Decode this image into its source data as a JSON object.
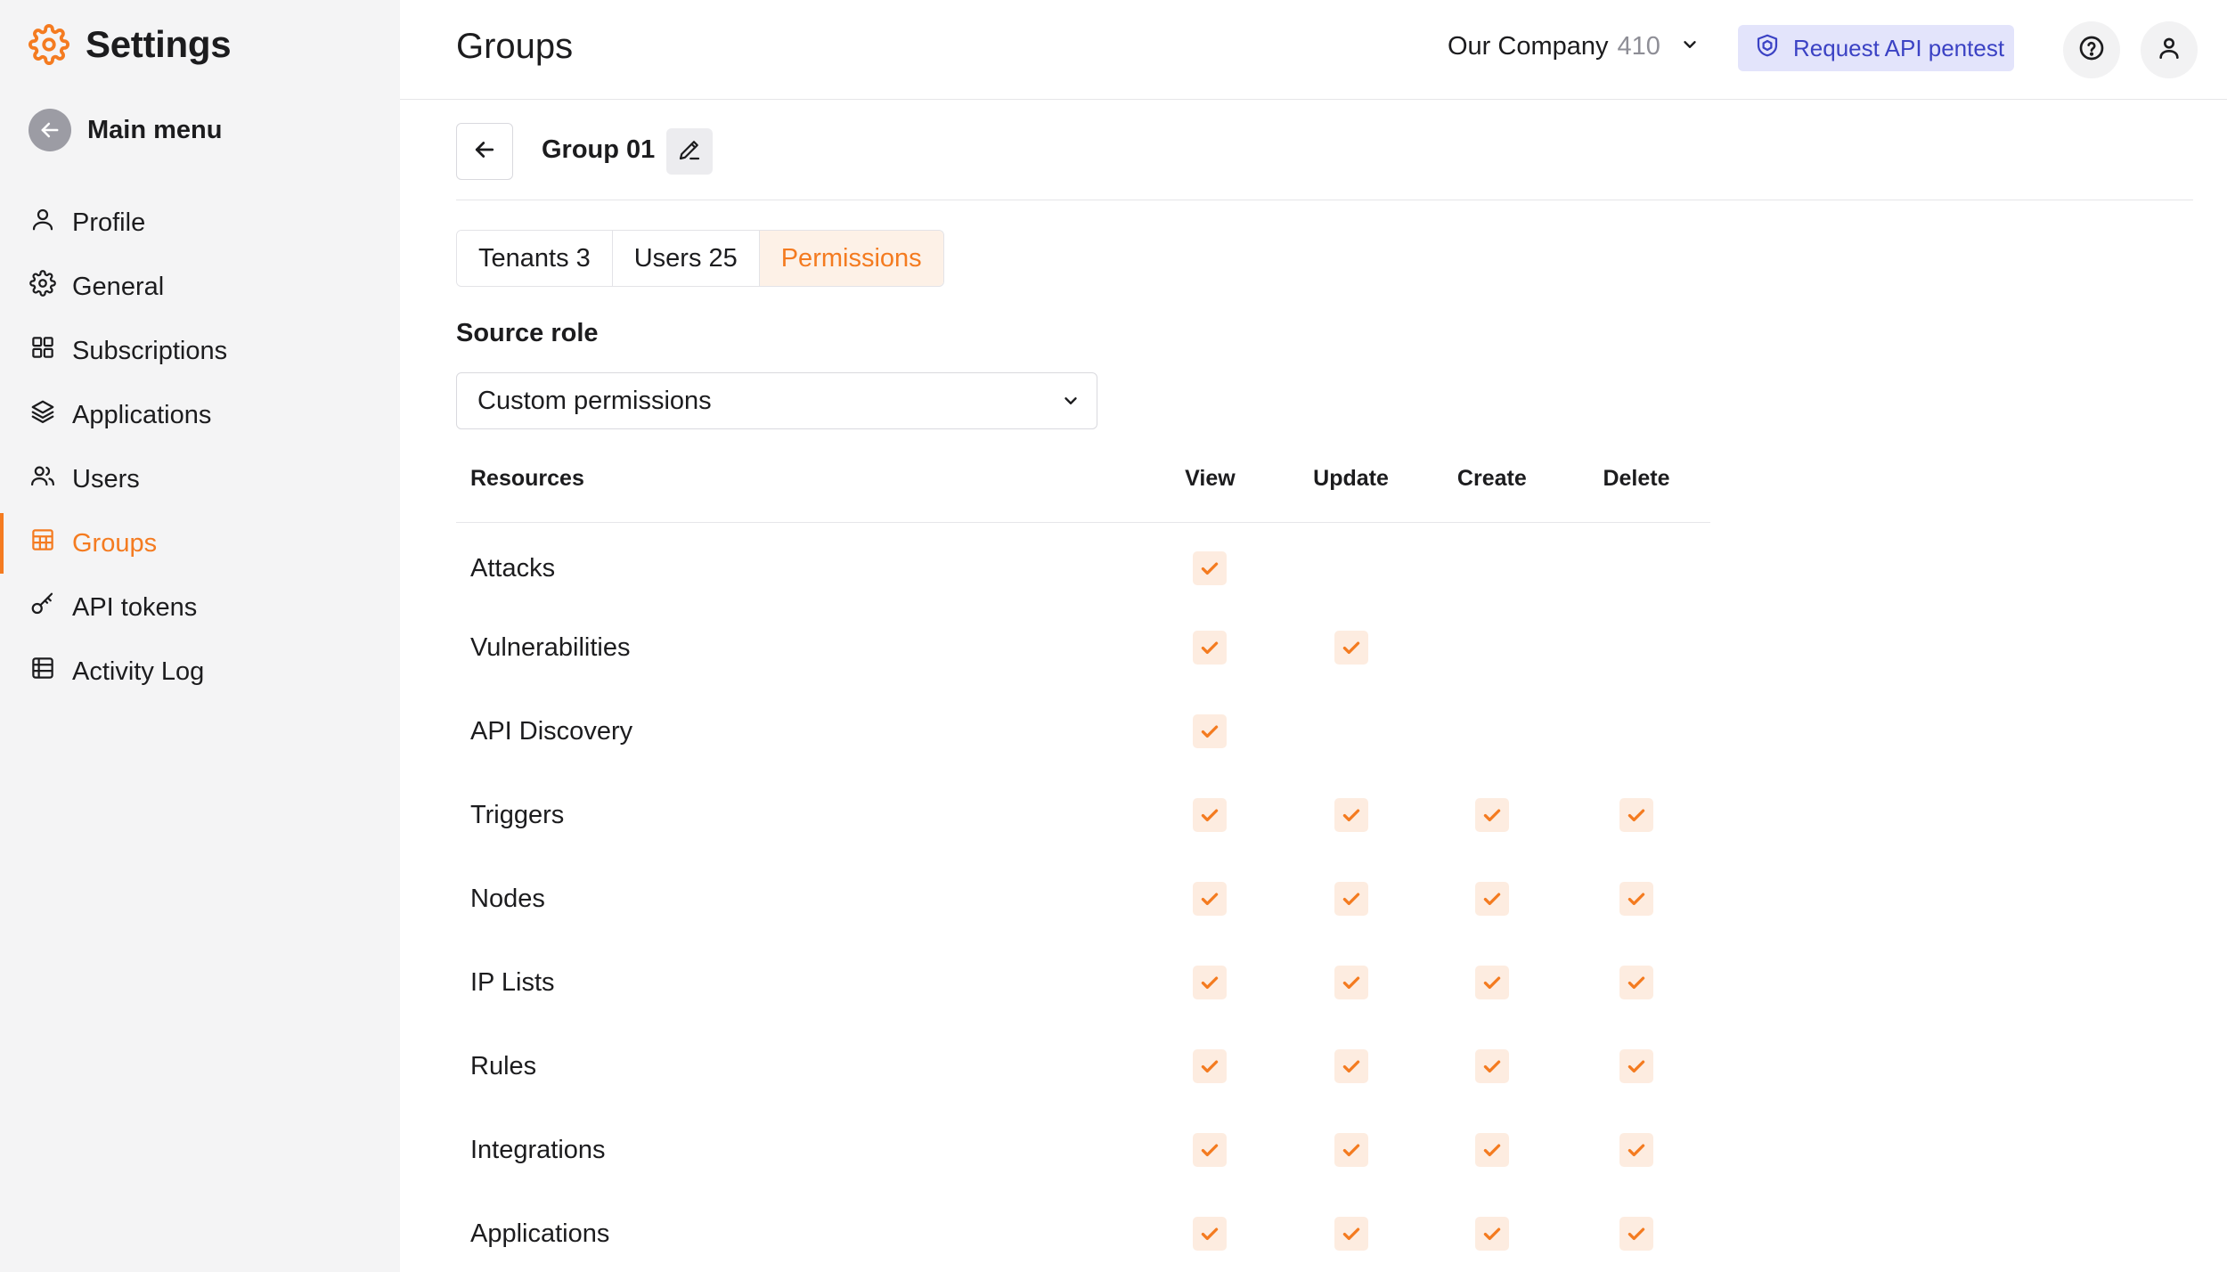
{
  "colors": {
    "accent": "#f47b20",
    "pentest_bg": "#e3e4fb",
    "pentest_fg": "#3b42c4",
    "sidebar_bg": "#f4f4f5"
  },
  "sidebar": {
    "title": "Settings",
    "title_icon": "gear-icon",
    "main_menu": "Main menu",
    "items": [
      {
        "label": "Profile",
        "icon": "user-icon",
        "active": false
      },
      {
        "label": "General",
        "icon": "gear-icon",
        "active": false
      },
      {
        "label": "Subscriptions",
        "icon": "grid-icon",
        "active": false
      },
      {
        "label": "Applications",
        "icon": "layers-icon",
        "active": false
      },
      {
        "label": "Users",
        "icon": "users-icon",
        "active": false
      },
      {
        "label": "Groups",
        "icon": "table-icon",
        "active": true
      },
      {
        "label": "API tokens",
        "icon": "key-icon",
        "active": false
      },
      {
        "label": "Activity Log",
        "icon": "list-icon",
        "active": false
      }
    ]
  },
  "header": {
    "title": "Groups",
    "company": "Our Company",
    "company_count": "410",
    "pentest_label": "Request API pentest"
  },
  "group": {
    "name": "Group 01",
    "tabs": [
      {
        "label": "Tenants",
        "count": "3",
        "active": false
      },
      {
        "label": "Users",
        "count": "25",
        "active": false
      },
      {
        "label": "Permissions",
        "count": "",
        "active": true
      }
    ],
    "source_role_label": "Source role",
    "source_role_value": "Custom permissions"
  },
  "permissions": {
    "columns": {
      "resource": "Resources",
      "view": "View",
      "update": "Update",
      "create": "Create",
      "delete": "Delete"
    },
    "rows": [
      {
        "resource": "Attacks",
        "view": true,
        "update": false,
        "create": false,
        "delete": false
      },
      {
        "resource": "Vulnerabilities",
        "view": true,
        "update": true,
        "create": false,
        "delete": false
      },
      {
        "resource": "API Discovery",
        "view": true,
        "update": false,
        "create": false,
        "delete": false
      },
      {
        "resource": "Triggers",
        "view": true,
        "update": true,
        "create": true,
        "delete": true
      },
      {
        "resource": "Nodes",
        "view": true,
        "update": true,
        "create": true,
        "delete": true
      },
      {
        "resource": "IP Lists",
        "view": true,
        "update": true,
        "create": true,
        "delete": true
      },
      {
        "resource": "Rules",
        "view": true,
        "update": true,
        "create": true,
        "delete": true
      },
      {
        "resource": "Integrations",
        "view": true,
        "update": true,
        "create": true,
        "delete": true
      },
      {
        "resource": "Applications",
        "view": true,
        "update": true,
        "create": true,
        "delete": true
      }
    ]
  }
}
